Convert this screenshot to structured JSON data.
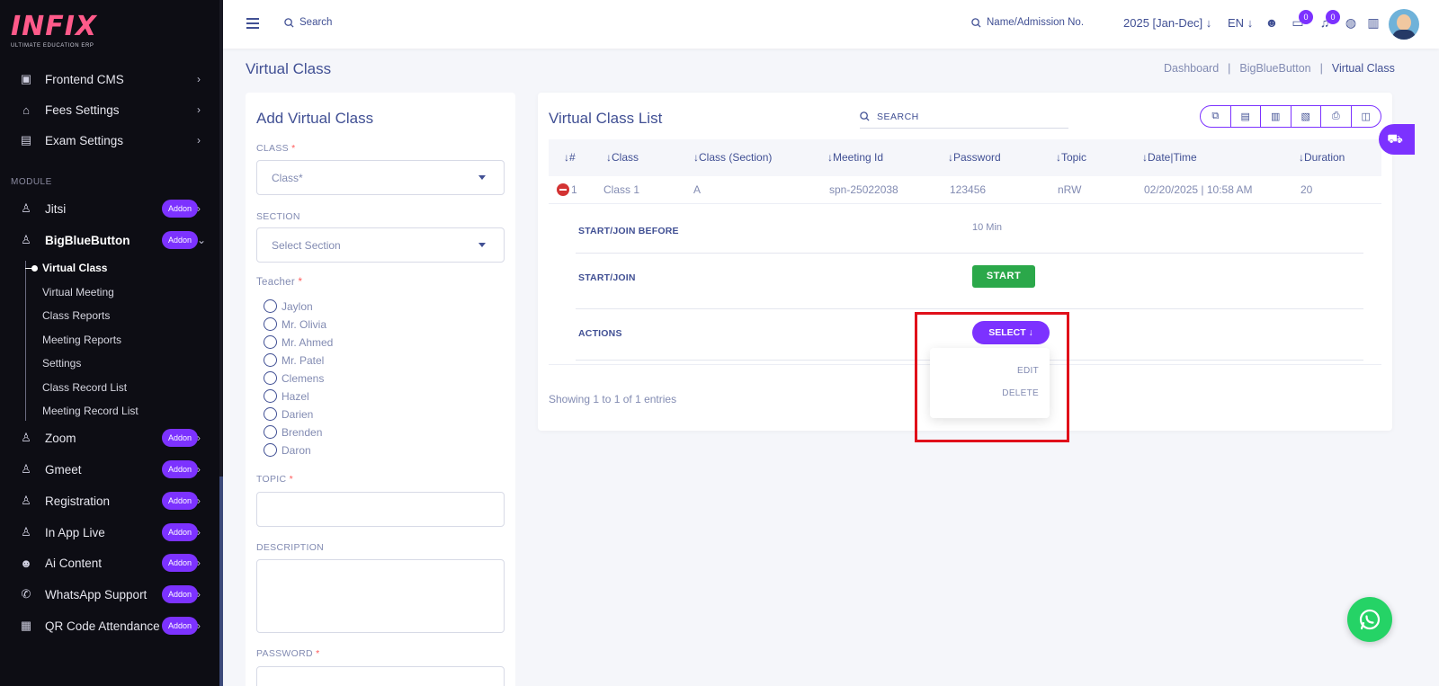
{
  "brand": {
    "logo": "INFIX",
    "tagline": "ULTIMATE EDUCATION ERP"
  },
  "sidebar": {
    "top_items": [
      {
        "label": "Frontend CMS",
        "icon": "monitor-icon"
      },
      {
        "label": "Fees Settings",
        "icon": "bank-icon"
      },
      {
        "label": "Exam Settings",
        "icon": "book-icon"
      }
    ],
    "module_label": "MODULE",
    "modules": [
      {
        "label": "Jitsi",
        "badge": "Addon"
      },
      {
        "label": "BigBlueButton",
        "badge": "Addon"
      },
      {
        "label": "Zoom",
        "badge": "Addon"
      },
      {
        "label": "Gmeet",
        "badge": "Addon"
      },
      {
        "label": "Registration",
        "badge": "Addon"
      },
      {
        "label": "In App Live",
        "badge": "Addon"
      },
      {
        "label": "Ai Content",
        "badge": "Addon"
      },
      {
        "label": "WhatsApp Support",
        "badge": "Addon"
      },
      {
        "label": "QR Code Attendance",
        "badge": "Addon"
      }
    ],
    "sub_items": [
      "Virtual Class",
      "Virtual Meeting",
      "Class Reports",
      "Meeting Reports",
      "Settings",
      "Class Record List",
      "Meeting Record List"
    ]
  },
  "header": {
    "search_placeholder": "Search",
    "admission_search": "Name/Admission No.",
    "academic_year": "2025 [Jan-Dec]",
    "language": "EN",
    "message_count": "0",
    "notification_count": "0"
  },
  "page": {
    "title": "Virtual Class",
    "breadcrumb": [
      "Dashboard",
      "|",
      "BigBlueButton",
      "|",
      "Virtual Class"
    ]
  },
  "form": {
    "title": "Add Virtual Class",
    "class_label": "CLASS",
    "class_placeholder": "Class*",
    "section_label": "SECTION",
    "section_placeholder": "Select Section",
    "teacher_label": "Teacher",
    "teachers": [
      "Jaylon",
      "Mr. Olivia",
      "Mr. Ahmed",
      "Mr. Patel",
      "Clemens",
      "Hazel",
      "Darien",
      "Brenden",
      "Daron"
    ],
    "topic_label": "TOPIC",
    "description_label": "DESCRIPTION",
    "password_label": "PASSWORD",
    "required_mark": "*"
  },
  "list": {
    "title": "Virtual Class List",
    "search_placeholder": "SEARCH",
    "columns": [
      "#",
      "Class",
      "Class (Section)",
      "Meeting Id",
      "Password",
      "Topic",
      "Date|Time",
      "Duration"
    ],
    "rows": [
      [
        "1",
        "Class 1",
        "A",
        "spn-25022038",
        "123456",
        "nRW",
        "02/20/2025 | 10:58 AM",
        "20"
      ]
    ],
    "detail": {
      "start_before_label": "START/JOIN BEFORE",
      "start_before_value": "10 Min",
      "start_join_label": "START/JOIN",
      "start_button": "START",
      "actions_label": "ACTIONS",
      "select_button": "SELECT",
      "menu": [
        "EDIT",
        "DELETE"
      ]
    },
    "showing": "Showing 1 to 1 of 1 entries"
  },
  "colors": {
    "accent": "#7c32ff",
    "text": "#415094",
    "muted": "#828bb2",
    "success": "#2ba84a",
    "danger": "#e0101a",
    "whatsapp": "#25d366"
  }
}
